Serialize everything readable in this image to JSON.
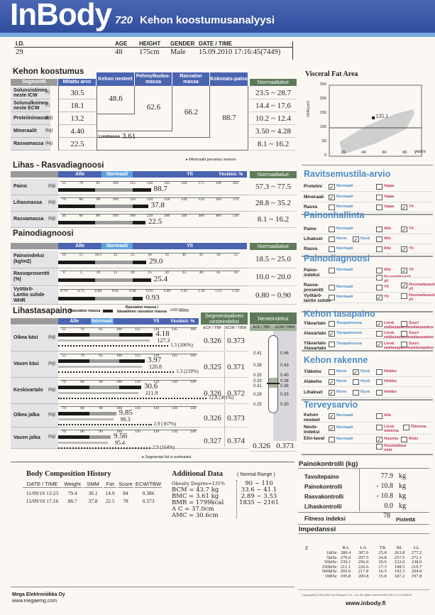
{
  "header": {
    "logo": "InBody",
    "model": "720",
    "title": "Kehon koostumusanalyysi"
  },
  "patient": {
    "labels": [
      "I.D.",
      "AGE",
      "HEIGHT",
      "GENDER",
      "DATE / TIME"
    ],
    "values": [
      "29",
      "48",
      "175cm",
      "Male",
      "15.09.2010 17:16:45(7449)"
    ]
  },
  "composition": {
    "title": "Kehon koostumus",
    "col_headers": [
      "Segmentti",
      "Mitattu arvo",
      "Kehon nesteet",
      "Pehmytkudos-massa",
      "Rasvaton massa",
      "Kokonais-paino",
      "Normaalialue"
    ],
    "rows": [
      {
        "label": "Solunsisäinen neste ICW",
        "unit": "(ℓ)",
        "value": "30.5",
        "normal": "23.5 ~ 28.7"
      },
      {
        "label": "Solunulkoinen neste ECW",
        "unit": "(ℓ)",
        "value": "18.1",
        "normal": "14.4 ~ 17.6"
      },
      {
        "label": "Proteiinimassa",
        "unit": "(kg)",
        "value": "13.2",
        "normal": "10.2 ~ 12.4"
      },
      {
        "label": "Mineraalit",
        "unit": "(kg)",
        "value": "4.40",
        "normal": "3.50 ~ 4.28"
      },
      {
        "label": "Rasvamassa",
        "unit": "(kg)",
        "value": "22.5",
        "normal": "8.1 ~ 16.2"
      }
    ],
    "body_water": "48.6",
    "soft_lean_mass": "62.6",
    "fat_free_mass": "66.2",
    "weight": "88.7",
    "bone_label": "Luumassa",
    "bone_value": "3.61",
    "note": "▸ Mineraalit perustuu arvioon"
  },
  "muscle_fat": {
    "title": "Lihas - Rasvadiagnoosi",
    "bands": [
      "Alle",
      "Normaali",
      "Yli"
    ],
    "unit": "Yksikkö: %",
    "normal_header": "Normaalialue",
    "rows": [
      {
        "label": "Paino",
        "unit": "(kg)",
        "ticks": [
          "55",
          "70",
          "85",
          "100",
          "115",
          "130",
          "145",
          "160",
          "175",
          "190",
          "205"
        ],
        "level": 131,
        "value": "88.7",
        "normal": "57.3 ~ 77.5"
      },
      {
        "label": "Lihasmassa",
        "unit": "(kg)",
        "ticks": [
          "70",
          "80",
          "90",
          "100",
          "110",
          "120",
          "130",
          "140",
          "150",
          "160",
          "170"
        ],
        "level": 119,
        "value": "37.8",
        "normal": "28.8 ~ 35.2"
      },
      {
        "label": "Rasvamassa",
        "unit": "(kg)",
        "ticks": [
          "40",
          "60",
          "80",
          "100",
          "160",
          "220",
          "280",
          "340",
          "400",
          "460",
          "520"
        ],
        "level": 205,
        "value": "22.5",
        "normal": "8.1 ~ 16.2"
      }
    ]
  },
  "weight_diag": {
    "title": "Painodiagnoosi",
    "bands": [
      "Alle",
      "Normaali",
      "Yli"
    ],
    "normal_header": "Normaalialue",
    "rows": [
      {
        "label": "Painoindeksi (kg/m2)",
        "ticks": [
          "10",
          "15",
          "18.5",
          "22",
          "25",
          "30",
          "35",
          "40",
          "45",
          "50",
          "55"
        ],
        "level": 29.0,
        "value": "29.0",
        "normal": "18.5 ~ 25.0"
      },
      {
        "label": "Rasvaprosentti (%)",
        "ticks": [
          "0",
          "5",
          "10",
          "15",
          "20",
          "25",
          "30",
          "35",
          "40",
          "45",
          "50"
        ],
        "level": 25.4,
        "value": "25.4",
        "normal": "10.0 ~ 20.0"
      },
      {
        "label": "Vyötärö-Lantio suhde WHR",
        "ticks": [
          "0.70",
          "0.75",
          "0.80",
          "0.85",
          "0.90",
          "0.95",
          "1.00",
          "1.05",
          "1.10",
          "1.15",
          "1.20"
        ],
        "level": 0.93,
        "value": "0.93",
        "normal": "0.80 ~ 0.90"
      }
    ]
  },
  "segmental": {
    "title": "Lihastasapaino",
    "legend1": "Rasvaton massa",
    "legend2": "Rasvaton massa / Ideaalinen rasvaton massa",
    "legend3": "x100 (%)",
    "bands": [
      "Alle",
      "Normaali",
      "Yli"
    ],
    "unit": "Yksikkö: %",
    "seg_header": "Segmentaalinen nesteindeksi",
    "col1": "ECF / TBF",
    "col2": "ECW / TBW",
    "rows": [
      {
        "label": "Oikea käsi",
        "unit": "(kg)",
        "ticks": [
          "55",
          "70",
          "85",
          "100",
          "115",
          "130",
          "145",
          "160"
        ],
        "lean_kg": "4.18",
        "lean_pct": 127.3,
        "lean_pct_text": "127.3",
        "fat_pct": 206,
        "fat_text": "1.3 (206%)",
        "ecf": "0.326",
        "ecw": "0.373"
      },
      {
        "label": "Vasen käsi",
        "unit": "(kg)",
        "ticks": [
          "55",
          "70",
          "85",
          "100",
          "115",
          "130",
          "145",
          "160"
        ],
        "lean_kg": "3.97",
        "lean_pct": 120.8,
        "lean_pct_text": "120.8",
        "fat_pct": 219,
        "fat_text": "1.3 (219%)",
        "ecf": "0.325",
        "ecw": "0.371"
      },
      {
        "label": "Keskivartalo",
        "unit": "(kg)",
        "ticks": [
          "70",
          "80",
          "90",
          "100",
          "110",
          "120",
          "130",
          "140"
        ],
        "lean_kg": "30.6",
        "lean_pct": 111.9,
        "lean_pct_text": "111.9",
        "fat_pct": 301,
        "fat_text": "12.8 (301%)",
        "ecf": "0.326",
        "ecw": "0.372"
      },
      {
        "label": "Oikea jalka",
        "unit": "(kg)",
        "ticks": [
          "70",
          "80",
          "90",
          "100",
          "110",
          "120",
          "130",
          "140"
        ],
        "lean_kg": "9.85",
        "lean_pct": 98.3,
        "lean_pct_text": "98.3",
        "fat_pct": 167,
        "fat_text": "2.9 (167%)",
        "ecf": "0.326",
        "ecw": "0.373"
      },
      {
        "label": "Vasen jalka",
        "unit": "(kg)",
        "ticks": [
          "70",
          "80",
          "90",
          "100",
          "110",
          "120",
          "130",
          "140"
        ],
        "lean_kg": "9.56",
        "lean_pct": 95.4,
        "lean_pct_text": "95.4",
        "fat_pct": 164,
        "fat_text": "2.9 (164%)",
        "ecf": "0.327",
        "ecw": "0.374"
      }
    ],
    "note": "▸ Segmental fat is estimated."
  },
  "fluid_index": {
    "title": "Nesteindeksi",
    "col1": "ECF / TBF",
    "col2": "ECW / TBW",
    "left_ticks": [
      "0.41",
      "0.38",
      "0.35",
      "0.33",
      "0.31",
      "0.28",
      "0.25"
    ],
    "right_ticks": [
      "0.46",
      "0.43",
      "0.40",
      "0.38",
      "0.36",
      "0.33",
      "0.30"
    ],
    "ecf": "0.326",
    "ecw": "0.373"
  },
  "vfa": {
    "title": "Visceral Fat Area",
    "chart_data": {
      "type": "scatter",
      "ylabel": "VFA(cm²)",
      "xlabel": "years",
      "x_ticks": [
        "20",
        "40",
        "60",
        "80"
      ],
      "y_ticks": [
        "0",
        "50",
        "100",
        "150",
        "200",
        "250"
      ],
      "ylim": [
        0,
        250
      ],
      "xlim": [
        5,
        95
      ],
      "reference_line": 100,
      "point": {
        "x": 48,
        "y": 135.1,
        "label": "135.1"
      }
    }
  },
  "nutrition": {
    "title": "Ravitsemustila-arvio",
    "rows": [
      {
        "label": "Proteiini",
        "opts": [
          {
            "t": "Normaali",
            "c": true,
            "k": "n"
          },
          {
            "t": "Vajaa",
            "c": false,
            "k": "a"
          }
        ]
      },
      {
        "label": "Mineraali",
        "opts": [
          {
            "t": "Normaali",
            "c": true,
            "k": "n"
          },
          {
            "t": "Vajaa",
            "c": false,
            "k": "a"
          }
        ]
      },
      {
        "label": "Rasva",
        "opts": [
          {
            "t": "Normaali",
            "c": false,
            "k": "n"
          },
          {
            "t": "Vajaa",
            "c": false,
            "k": "a"
          },
          {
            "t": "Yli",
            "c": true,
            "k": "a"
          }
        ]
      }
    ]
  },
  "weight_mgmt": {
    "title": "Painonhallinta",
    "rows": [
      {
        "label": "Paino",
        "opts": [
          {
            "t": "Normaali",
            "c": false,
            "k": "n"
          },
          {
            "t": "Alle",
            "c": false,
            "k": "a"
          },
          {
            "t": "Yli",
            "c": true,
            "k": "a"
          }
        ]
      },
      {
        "label": "Lihakset",
        "opts": [
          {
            "t": "Norm",
            "c": false,
            "k": "n"
          },
          {
            "t": "Hyvä",
            "c": true,
            "k": "n"
          },
          {
            "t": "Alle",
            "c": false,
            "k": "a"
          }
        ]
      },
      {
        "label": "Rasva",
        "opts": [
          {
            "t": "Normaali",
            "c": false,
            "k": "n"
          },
          {
            "t": "Alle",
            "c": false,
            "k": "a"
          },
          {
            "t": "Yli",
            "c": true,
            "k": "a"
          }
        ]
      }
    ]
  },
  "obesity_diag": {
    "title": "Painodiagnoosi",
    "rows": [
      {
        "label": "Paino-indeksi",
        "opts": [
          {
            "t": "Normaali",
            "c": false,
            "k": "n"
          },
          {
            "t": "Alle",
            "c": false,
            "k": "a"
          },
          {
            "t": "Yli",
            "c": true,
            "k": "a"
          },
          {
            "t": "Huomattavasti yli",
            "c": false,
            "k": "a"
          }
        ]
      },
      {
        "label": "Rasva-prosentti",
        "opts": [
          {
            "t": "Normaali",
            "c": false,
            "k": "n"
          },
          {
            "t": "Yli",
            "c": false,
            "k": "a"
          },
          {
            "t": "Huomattavasti yli",
            "c": true,
            "k": "a"
          }
        ]
      },
      {
        "label": "Vyötärö-lantio suhde",
        "opts": [
          {
            "t": "Normaali",
            "c": false,
            "k": "n"
          },
          {
            "t": "Yli",
            "c": true,
            "k": "a"
          },
          {
            "t": "Huomattavasti yli",
            "c": false,
            "k": "a"
          }
        ]
      }
    ]
  },
  "balance": {
    "title": "Kehon tasapaino",
    "rows": [
      {
        "label": "Ylävartalo",
        "opts": [
          {
            "t": "Tasapainossa",
            "c": false,
            "k": "n"
          },
          {
            "t": "Lievä epätasapaino",
            "c": true,
            "k": "a"
          },
          {
            "t": "Suuri epätasapaino",
            "c": false,
            "k": "a"
          }
        ]
      },
      {
        "label": "Alavartalo",
        "opts": [
          {
            "t": "Tasapainossa",
            "c": true,
            "k": "n"
          },
          {
            "t": "Lievä epätasapaino",
            "c": false,
            "k": "a"
          },
          {
            "t": "Suuri epätasapaino",
            "c": false,
            "k": "a"
          }
        ]
      },
      {
        "label": "Ylävartalo Alavartalo",
        "opts": [
          {
            "t": "Tasapainossa",
            "c": false,
            "k": "n"
          },
          {
            "t": "Lievä epätasapaino",
            "c": true,
            "k": "a"
          },
          {
            "t": "Suuri epätasapaino",
            "c": false,
            "k": "a"
          }
        ]
      }
    ]
  },
  "structure": {
    "title": "Kehon rakenne",
    "rows": [
      {
        "label": "Yläkeho",
        "opts": [
          {
            "t": "Norm",
            "c": false,
            "k": "n"
          },
          {
            "t": "Hyvä",
            "c": true,
            "k": "n"
          },
          {
            "t": "Heikko",
            "c": false,
            "k": "a"
          }
        ]
      },
      {
        "label": "Alakeho",
        "opts": [
          {
            "t": "Norm",
            "c": true,
            "k": "n"
          },
          {
            "t": "Hyvä",
            "c": false,
            "k": "n"
          },
          {
            "t": "Heikko",
            "c": false,
            "k": "a"
          }
        ]
      },
      {
        "label": "Lihakset",
        "opts": [
          {
            "t": "Norm",
            "c": true,
            "k": "n"
          },
          {
            "t": "Hyvä",
            "c": false,
            "k": "n"
          },
          {
            "t": "Heikko",
            "c": false,
            "k": "a"
          }
        ]
      }
    ]
  },
  "health": {
    "title": "Terveysarvio",
    "rows": [
      {
        "label": "Kehon nesteet",
        "opts": [
          {
            "t": "Normaali",
            "c": true,
            "k": "n"
          },
          {
            "t": "Alle",
            "c": false,
            "k": "a"
          }
        ]
      },
      {
        "label": "Neste-indeksi",
        "opts": [
          {
            "t": "Normaali",
            "c": true,
            "k": "n"
          },
          {
            "t": "Lievä ödeema",
            "c": false,
            "k": "a"
          },
          {
            "t": "Ödeema",
            "c": false,
            "k": "a"
          }
        ]
      },
      {
        "label": "Elin-tavat",
        "opts": [
          {
            "t": "Normaali",
            "c": false,
            "k": "n"
          },
          {
            "t": "Huomio",
            "c": true,
            "k": "a"
          },
          {
            "t": "Riski",
            "c": false,
            "k": "a"
          },
          {
            "t": "Huomattava riski",
            "c": false,
            "k": "a"
          }
        ]
      }
    ]
  },
  "weight_control": {
    "title": "Painokontrolli (kg)",
    "rows": [
      {
        "label": "Tavoitepaino",
        "value": "77.9",
        "unit": "kg"
      },
      {
        "label": "Painokontrolli",
        "value": "- 10.8",
        "unit": "kg"
      },
      {
        "label": "Rasvakontrolli",
        "value": "- 10.8",
        "unit": "kg"
      },
      {
        "label": "Lihaskontrolli",
        "value": "0.0",
        "unit": "kg"
      }
    ],
    "fitness_label": "Fitness indeksi",
    "fitness_value": "78",
    "fitness_unit": "Pistettä"
  },
  "impedance": {
    "title": "Impedanssi",
    "corner": "Z",
    "cols": [
      "RA",
      "LA",
      "TR",
      "RL",
      "LL"
    ],
    "rows": [
      {
        "f": "1kHz:",
        "v": [
          "289.4",
          "307.0",
          "25.8",
          "263.8",
          "277.2"
        ]
      },
      {
        "f": "5kHz:",
        "v": [
          "279.0",
          "297.5",
          "24.8",
          "257.5",
          "272.1"
        ]
      },
      {
        "f": "50kHz:",
        "v": [
          "239.1",
          "256.0",
          "20.6",
          "222.0",
          "238.0"
        ]
      },
      {
        "f": "250kHz:",
        "v": [
          "211.1",
          "226.6",
          "17.3",
          "198.5",
          "210.7"
        ]
      },
      {
        "f": "500kHz:",
        "v": [
          "202.6",
          "217.8",
          "16.5",
          "192.3",
          "204.0"
        ]
      },
      {
        "f": "1MHz:",
        "v": [
          "195.8",
          "209.8",
          "15.8",
          "187.2",
          "197.8"
        ]
      }
    ]
  },
  "history": {
    "title": "Body Composition History",
    "headers": [
      "DATE / TIME",
      "Weight",
      "SMM",
      "Fat",
      "Score",
      "ECW/TBW"
    ],
    "rows": [
      [
        "11/09/10 13:23",
        "79.4",
        "36.1",
        "14.9",
        "84",
        "0.386"
      ],
      [
        "15/09/10 17:16",
        "88.7",
        "37.8",
        "22.5",
        "78",
        "0.373"
      ]
    ]
  },
  "additional": {
    "title": "Additional Data",
    "range_title": "( Normal Range )",
    "lines": [
      "Obesity Degree=131%",
      "BCM = 43.7 kg",
      "BMC = 3.61 kg",
      "BMR = 1799kcal",
      "A C = 37.0cm",
      "AMC = 30.6cm"
    ],
    "ranges": [
      "90 ~ 110",
      "33.6 ~ 41.1",
      "2.89 ~ 3.53",
      "1835 ~ 2161"
    ]
  },
  "footer": {
    "company": "Mega Elektroniikka Oy",
    "company_url": "www.megaemg.com",
    "copyright": "Copyright(C)1996-2004 by Biospace Co., Ltd. All rights reserved BR-ENG-27-A-040823",
    "url": "www.inbody.fi"
  },
  "colors": {
    "header_blue": "#3a57a6",
    "band_blue": "#4a64b0",
    "normal_band": "#5fa0dc",
    "normal_green": "#5e7a5a",
    "title_blue": "#4a8cc6",
    "abnormal_red": "#c0345f"
  }
}
